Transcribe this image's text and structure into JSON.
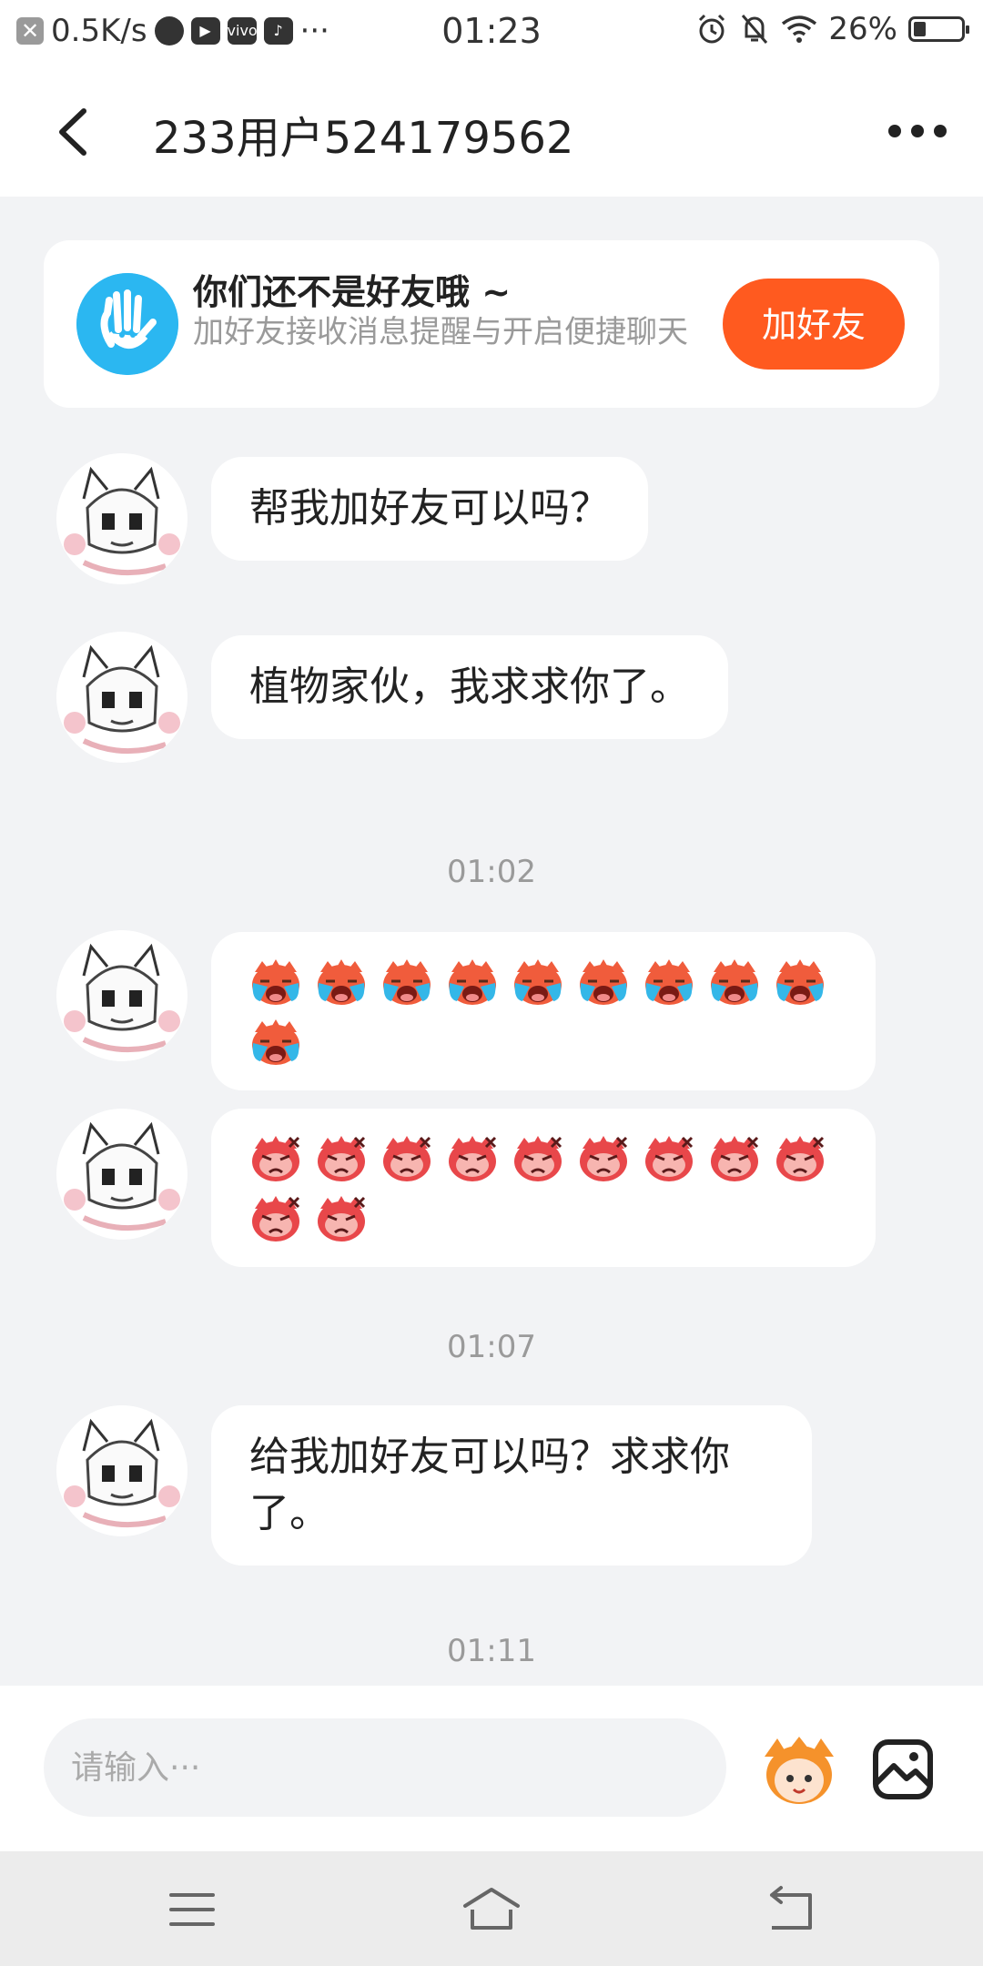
{
  "status_bar": {
    "net_speed": "0.5K/s",
    "time": "01:23",
    "battery": "26%",
    "battery_level": 0.26,
    "app_icons": [
      "close-icon",
      "planet-icon",
      "video-icon",
      "vivo-icon",
      "music-icon"
    ],
    "status_icons": [
      "alarm-icon",
      "notifications-off-icon",
      "wifi-icon",
      "battery-icon"
    ],
    "more": "···"
  },
  "header": {
    "title": "233用户524179562"
  },
  "banner": {
    "title": "你们还不是好友哦 ~",
    "subtitle": "加好友接收消息提醒与开启便捷聊天",
    "button_label": "加好友"
  },
  "messages": [
    {
      "type": "text",
      "text": "帮我加好友可以吗？"
    },
    {
      "type": "text",
      "text": "植物家伙，我求求你了。"
    },
    {
      "type": "timestamp",
      "text": "01:02"
    },
    {
      "type": "emoji",
      "emoji": "crying-emoji",
      "count": 10
    },
    {
      "type": "emoji",
      "emoji": "angry-emoji",
      "count": 11
    },
    {
      "type": "timestamp",
      "text": "01:07"
    },
    {
      "type": "text",
      "text": "给我加好友可以吗？求求你了。"
    },
    {
      "type": "timestamp",
      "text": "01:11"
    }
  ],
  "input": {
    "placeholder": "请输入···"
  },
  "colors": {
    "accent": "#ff5a1f",
    "banner_icon": "#2bb7f1",
    "background": "#f2f3f5",
    "bubble": "#ffffff",
    "crying_emoji_face": "#f05c3c",
    "crying_emoji_tears": "#34b7e8",
    "angry_emoji_face": "#e8474a"
  }
}
